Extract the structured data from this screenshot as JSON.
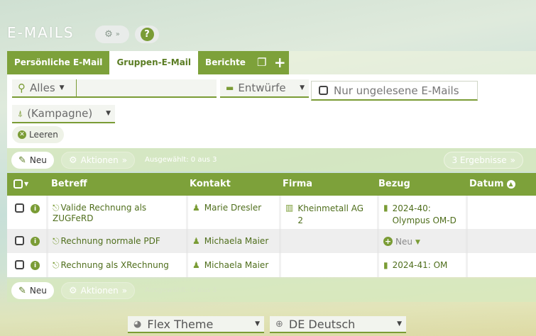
{
  "app": {
    "title": "E-MAILS"
  },
  "header": {
    "settings_icon": "gear-icon",
    "help_icon": "help-icon",
    "help_glyph": "?"
  },
  "tabs": [
    {
      "label": "Persönliche E-Mail"
    },
    {
      "label": "Gruppen-E-Mail",
      "active": true
    },
    {
      "label": "Berichte"
    }
  ],
  "filters": {
    "scope": "Alles",
    "search_value": "",
    "folder": "Entwürfe",
    "unread_label": "Nur ungelesene E-Mails",
    "campaign": "(Kampagne)",
    "clear_label": "Leeren"
  },
  "toolbar": {
    "new_label": "Neu",
    "actions_label": "Aktionen",
    "selected_info": "Ausgewählt: 0 aus 3",
    "results_label": "3 Ergebnisse"
  },
  "table": {
    "columns": [
      "Betreff",
      "Kontakt",
      "Firma",
      "Bezug",
      "Datum"
    ],
    "rows": [
      {
        "subject": "Valide Rechnung als ZUGFeRD",
        "contact": "Marie Dresler",
        "company": "Kheinmetall AG 2",
        "reference": "2024-40: Olympus OM-D",
        "date": ""
      },
      {
        "subject": "Rechnung normale PDF",
        "contact": "Michaela Maier",
        "company": "",
        "reference_new": "Neu",
        "date": ""
      },
      {
        "subject": "Rechnung als XRechnung",
        "contact": "Michaela Maier",
        "company": "",
        "reference": "2024-41: OM",
        "date": ""
      }
    ]
  },
  "footer": {
    "theme": "Flex Theme",
    "language": "DE Deutsch"
  },
  "colors": {
    "accent": "#7da13a",
    "accent_dark": "#5b7d24"
  }
}
